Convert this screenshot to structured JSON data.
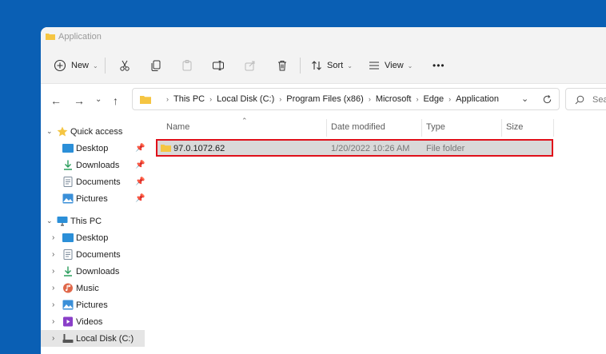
{
  "window": {
    "title": "Application"
  },
  "toolbar": {
    "new_label": "New",
    "sort_label": "Sort",
    "view_label": "View",
    "more_label": "•••"
  },
  "address": {
    "crumbs": [
      "This PC",
      "Local Disk (C:)",
      "Program Files (x86)",
      "Microsoft",
      "Edge",
      "Application"
    ],
    "search_placeholder": "Sea"
  },
  "sidebar": {
    "quick_access_label": "Quick access",
    "quick_access_items": [
      {
        "label": "Desktop",
        "icon": "desktop-folder-icon"
      },
      {
        "label": "Downloads",
        "icon": "downloads-icon"
      },
      {
        "label": "Documents",
        "icon": "documents-icon"
      },
      {
        "label": "Pictures",
        "icon": "pictures-icon"
      }
    ],
    "this_pc_label": "This PC",
    "this_pc_items": [
      {
        "label": "Desktop",
        "icon": "desktop-folder-icon"
      },
      {
        "label": "Documents",
        "icon": "documents-icon"
      },
      {
        "label": "Downloads",
        "icon": "downloads-icon"
      },
      {
        "label": "Music",
        "icon": "music-icon"
      },
      {
        "label": "Pictures",
        "icon": "pictures-icon"
      },
      {
        "label": "Videos",
        "icon": "videos-icon"
      },
      {
        "label": "Local Disk (C:)",
        "icon": "drive-icon"
      }
    ]
  },
  "columns": {
    "name": "Name",
    "date_modified": "Date modified",
    "type": "Type",
    "size": "Size"
  },
  "files": [
    {
      "name": "97.0.1072.62",
      "date_modified": "1/20/2022 10:26 AM",
      "type": "File folder",
      "size": ""
    }
  ],
  "colors": {
    "desktop_blue": "#0a5fb4",
    "highlight_red": "#e0101a",
    "folder_yellow": "#f5c542"
  }
}
